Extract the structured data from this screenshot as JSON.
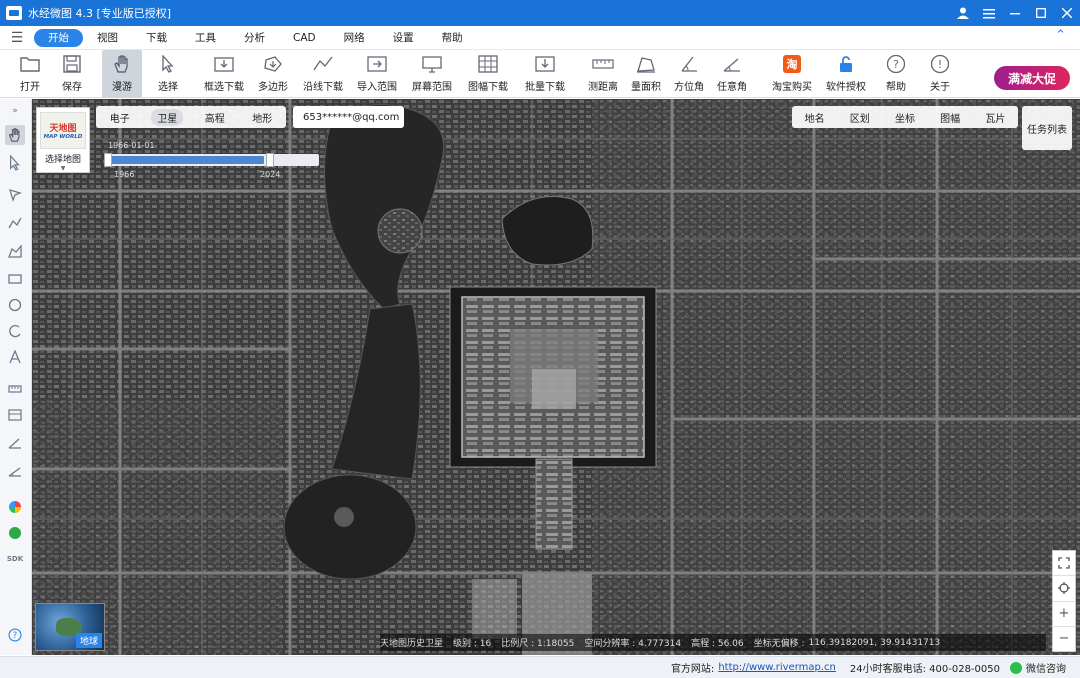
{
  "app": {
    "title": "水经微图 4.3 [专业版已授权]"
  },
  "menu": {
    "items": [
      "开始",
      "视图",
      "下载",
      "工具",
      "分析",
      "CAD",
      "网络",
      "设置",
      "帮助"
    ],
    "active": "开始"
  },
  "toolbar": {
    "open": "打开",
    "save": "保存",
    "pan": "漫游",
    "select": "选择",
    "rect_download": "框选下载",
    "polygon": "多边形",
    "line_download": "沿线下载",
    "import_range": "导入范围",
    "screen_range": "屏幕范围",
    "sheet_download": "图幅下载",
    "batch_download": "批量下载",
    "measure_distance": "测距离",
    "measure_area": "量面积",
    "bearing": "方位角",
    "any_angle": "任意角",
    "taobao": "淘宝购买",
    "license": "软件授权",
    "help": "帮助",
    "about": "关于",
    "promo": "满减大促"
  },
  "map_panel": {
    "style_caption": "选择地图",
    "logo_cn": "天地图",
    "logo_en": "MAP WORLD",
    "tabs": [
      "电子",
      "卫星",
      "高程",
      "地形"
    ],
    "active_tab": "卫星",
    "account": "653******@qq.com",
    "timeline_date": "1966-01-01",
    "timeline_start": "1966",
    "timeline_end": "2024",
    "right_tabs": [
      "地名",
      "区划",
      "坐标",
      "图幅",
      "瓦片"
    ],
    "task_list": "任务列表",
    "globe_label": "地球"
  },
  "status": {
    "source": "天地图历史卫星",
    "level": "级别 : 16",
    "scale": "比例尺 : 1:18055",
    "resolution": "空间分辨率 : 4.777314",
    "elevation": "高程 : 56.06",
    "coord_label": "坐标无偏移 :",
    "coords": "116.39182091, 39.91431713"
  },
  "footer": {
    "site_label": "官方网站:",
    "site_url": "http://www.rivermap.cn",
    "hotline": "24小时客服电话: 400-028-0050",
    "wechat": "微信咨询"
  }
}
